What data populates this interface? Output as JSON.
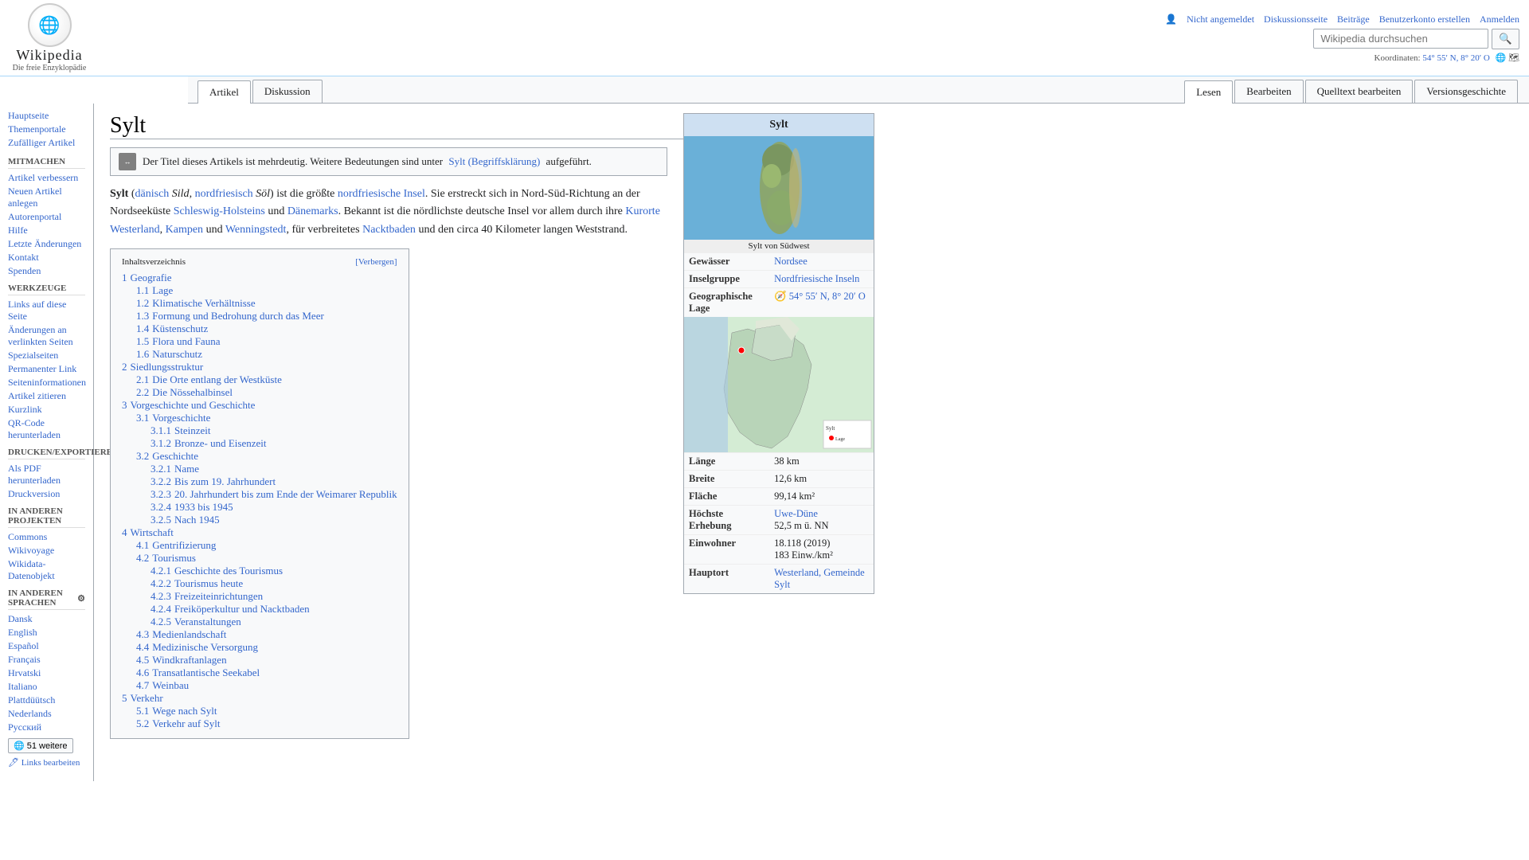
{
  "header": {
    "logo_text": "Wikipedia",
    "logo_sub": "Die freie Enzyklopädie",
    "user_not_logged": "Nicht angemeldet",
    "nav_links": [
      "Diskussionsseite",
      "Beiträge",
      "Benutzerkonto erstellen",
      "Anmelden"
    ],
    "search_placeholder": "Wikipedia durchsuchen",
    "search_button": "🔍",
    "coords_label": "Koordinaten:",
    "coords_value": "54° 55′ N, 8° 20′ O"
  },
  "tabs": [
    {
      "label": "Artikel",
      "active": true
    },
    {
      "label": "Diskussion",
      "active": false
    },
    {
      "label": "Lesen",
      "active": true
    },
    {
      "label": "Bearbeiten",
      "active": false
    },
    {
      "label": "Quelltext bearbeiten",
      "active": false
    },
    {
      "label": "Versionsgeschichte",
      "active": false
    }
  ],
  "sidebar": {
    "sections": [
      {
        "heading": "",
        "items": [
          "Hauptseite",
          "Themenportale",
          "Zufälliger Artikel"
        ]
      },
      {
        "heading": "Mitmachen",
        "items": [
          "Artikel verbessern",
          "Neuen Artikel anlegen",
          "Autorenportal",
          "Hilfe",
          "Letzte Änderungen",
          "Kontakt",
          "Spenden"
        ]
      },
      {
        "heading": "Werkzeuge",
        "items": [
          "Links auf diese Seite",
          "Änderungen an verlinkten Seiten",
          "Spezialseiten",
          "Permanenter Link",
          "Seiteninformationen",
          "Artikel zitieren",
          "Kurzlink",
          "QR-Code herunterladen"
        ]
      },
      {
        "heading": "Drucken/exportieren",
        "items": [
          "Als PDF herunterladen",
          "Druckversion"
        ]
      },
      {
        "heading": "In anderen Projekten",
        "items": [
          "Commons",
          "Wikivoyage",
          "Wikidata-Datenobjekt"
        ]
      },
      {
        "heading": "In anderen Sprachen",
        "items": [
          "Dansk",
          "English",
          "Español",
          "Français",
          "Hrvatski",
          "Italiano",
          "Plattdüütsch",
          "Nederlands",
          "Русский",
          "51 weitere"
        ]
      }
    ]
  },
  "page": {
    "title": "Sylt",
    "disambiguation_text": "Der Titel dieses Artikels ist mehrdeutig. Weitere Bedeutungen sind unter",
    "disambiguation_link": "Sylt (Begriffsklärung)",
    "disambiguation_suffix": "aufgeführt.",
    "intro": "Sylt (dänisch Sild, nordfriesisch Söl) ist die größte nordfriesische Insel. Sie erstreckt sich in Nord-Süd-Richtung an der Nordseeküste Schleswig-Holsteins und Dänemarks. Bekannt ist die nördlichste deutsche Insel vor allem durch ihre Kurorte Westerland, Kampen und Wenningstedt, für verbreitetes Nacktbaden und den circa 40 Kilometer langen Weststrand.",
    "toc_title": "Inhaltsverzeichnis",
    "toc_hide_label": "[Verbergen]",
    "toc": [
      {
        "num": "1",
        "label": "Geografie",
        "sub": [
          {
            "num": "1.1",
            "label": "Lage"
          },
          {
            "num": "1.2",
            "label": "Klimatische Verhältnisse"
          },
          {
            "num": "1.3",
            "label": "Formung und Bedrohung durch das Meer"
          },
          {
            "num": "1.4",
            "label": "Küstenschutz"
          },
          {
            "num": "1.5",
            "label": "Flora und Fauna"
          },
          {
            "num": "1.6",
            "label": "Naturschutz"
          }
        ]
      },
      {
        "num": "2",
        "label": "Siedlungsstruktur",
        "sub": [
          {
            "num": "2.1",
            "label": "Die Orte entlang der Westküste"
          },
          {
            "num": "2.2",
            "label": "Die Nössehalbinsel"
          }
        ]
      },
      {
        "num": "3",
        "label": "Vorgeschichte und Geschichte",
        "sub": [
          {
            "num": "3.1",
            "label": "Vorgeschichte",
            "sub2": [
              {
                "num": "3.1.1",
                "label": "Steinzeit"
              },
              {
                "num": "3.1.2",
                "label": "Bronze- und Eisenzeit"
              }
            ]
          },
          {
            "num": "3.2",
            "label": "Geschichte",
            "sub2": [
              {
                "num": "3.2.1",
                "label": "Name"
              },
              {
                "num": "3.2.2",
                "label": "Bis zum 19. Jahrhundert"
              },
              {
                "num": "3.2.3",
                "label": "20. Jahrhundert bis zum Ende der Weimarer Republik"
              },
              {
                "num": "3.2.4",
                "label": "1933 bis 1945"
              },
              {
                "num": "3.2.5",
                "label": "Nach 1945"
              }
            ]
          }
        ]
      },
      {
        "num": "4",
        "label": "Wirtschaft",
        "sub": [
          {
            "num": "4.1",
            "label": "Gentrifizierung"
          },
          {
            "num": "4.2",
            "label": "Tourismus",
            "sub2": [
              {
                "num": "4.2.1",
                "label": "Geschichte des Tourismus"
              },
              {
                "num": "4.2.2",
                "label": "Tourismus heute"
              },
              {
                "num": "4.2.3",
                "label": "Freizeiteinrichtungen"
              },
              {
                "num": "4.2.4",
                "label": "Freiköperkultur und Nacktbaden"
              },
              {
                "num": "4.2.5",
                "label": "Veranstaltungen"
              }
            ]
          },
          {
            "num": "4.3",
            "label": "Medienlandschaft"
          },
          {
            "num": "4.4",
            "label": "Medizinische Versorgung"
          },
          {
            "num": "4.5",
            "label": "Windkraftanlagen"
          },
          {
            "num": "4.6",
            "label": "Transatlantische Seekabel"
          },
          {
            "num": "4.7",
            "label": "Weinbau"
          }
        ]
      },
      {
        "num": "5",
        "label": "Verkehr",
        "sub": [
          {
            "num": "5.1",
            "label": "Wege nach Sylt"
          },
          {
            "num": "5.2",
            "label": "Verkehr auf Sylt"
          }
        ]
      }
    ]
  },
  "infobox": {
    "title": "Sylt",
    "img_caption": "Sylt von Südwest",
    "rows": [
      {
        "label": "Gewässer",
        "value": "Nordsee"
      },
      {
        "label": "Inselgruppe",
        "value": "Nordfriesische Inseln"
      },
      {
        "label": "Geographische Lage",
        "value": "54° 55′ N, 8° 20′ O"
      },
      {
        "label": "Länge",
        "value": "38 km"
      },
      {
        "label": "Breite",
        "value": "12,6 km"
      },
      {
        "label": "Fläche",
        "value": "99,14 km²"
      },
      {
        "label": "Höchste Erhebung",
        "value": "Uwe-Düne\n52,5 m ü. NN"
      },
      {
        "label": "Einwohner",
        "value": "18.118 (2019)\n183 Einw./km²"
      },
      {
        "label": "Hauptort",
        "value": "Westerland, Gemeinde Sylt"
      }
    ]
  },
  "links_panel": {
    "label": "51 weitere",
    "links_baarbeiten": "Links bearbeiten"
  }
}
